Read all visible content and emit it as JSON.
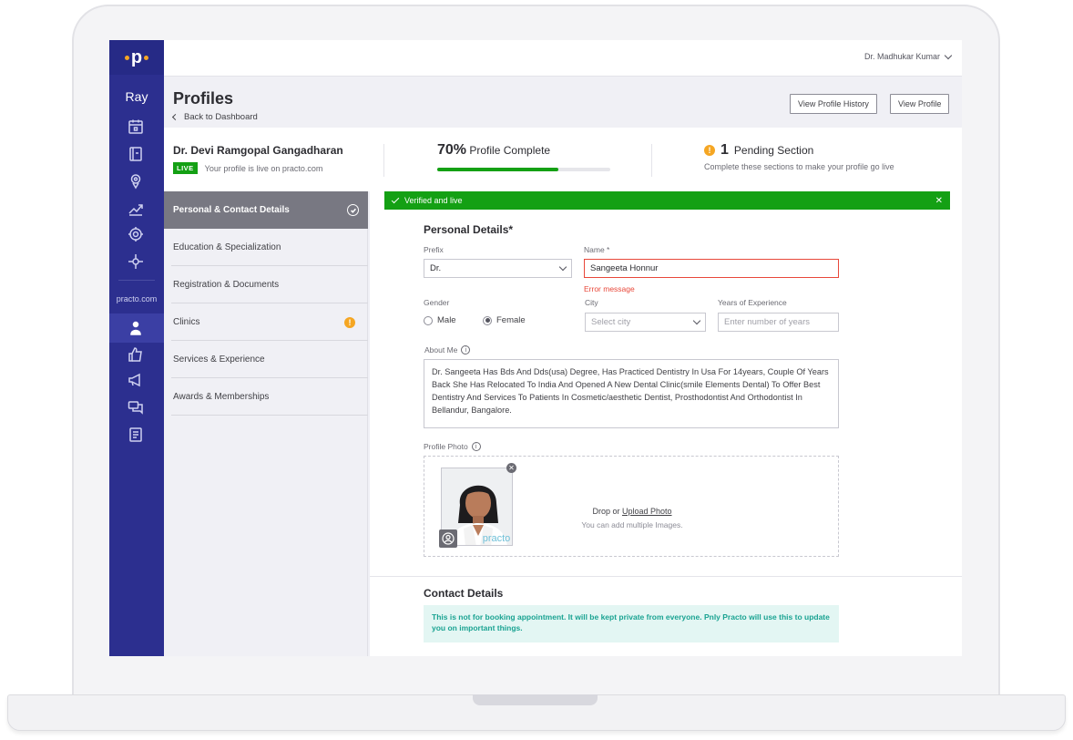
{
  "brand": {
    "logo_text": "p",
    "product": "Ray",
    "site": "practo.com"
  },
  "header": {
    "user_name": "Dr. Madhukar Kumar"
  },
  "page": {
    "title": "Profiles",
    "back_label": "Back to Dashboard",
    "history_button": "View Profile History",
    "view_button": "View Profile"
  },
  "summary": {
    "doctor_name": "Dr. Devi Ramgopal Gangadharan",
    "live_badge": "LIVE",
    "live_text": "Your profile is live on practo.com",
    "progress_percent": 70,
    "progress_value_text": "70%",
    "progress_label": "Profile Complete",
    "pending_count": "1",
    "pending_label": "Pending Section",
    "pending_sub": "Complete these sections to make your profile go live"
  },
  "sections": [
    {
      "label": "Personal & Contact Details",
      "status": "done"
    },
    {
      "label": "Education & Specialization",
      "status": ""
    },
    {
      "label": "Registration & Documents",
      "status": ""
    },
    {
      "label": "Clinics",
      "status": "warning"
    },
    {
      "label": "Services & Experience",
      "status": ""
    },
    {
      "label": "Awards & Memberships",
      "status": ""
    }
  ],
  "banner": {
    "text": "Verified and live"
  },
  "personal": {
    "title": "Personal Details*",
    "prefix_label": "Prefix",
    "prefix_value": "Dr.",
    "name_label": "Name *",
    "name_value": "Sangeeta Honnur",
    "name_error": "Error message",
    "gender_label": "Gender",
    "gender_options": [
      "Male",
      "Female"
    ],
    "gender_selected": "Female",
    "city_label": "City",
    "city_placeholder": "Select city",
    "experience_label": "Years of Experience",
    "experience_placeholder": "Enter number of years",
    "about_label": "About Me",
    "about_value": "Dr. Sangeeta Has Bds And Dds(usa) Degree, Has Practiced Dentistry In Usa For 14years, Couple Of Years Back She Has Relocated To India And Opened A New Dental Clinic(smile Elements Dental) To Offer Best Dentistry And Services To Patients In Cosmetic/aesthetic Dentist, Prosthodontist And Orthodontist In Bellandur, Bangalore.",
    "photo_label": "Profile Photo",
    "photo_watermark": "practo",
    "drop_prefix": "Drop or",
    "drop_link": "Upload Photo",
    "drop_sub": "You can add multiple Images."
  },
  "contact": {
    "title": "Contact Details",
    "notice": "This is not for booking appointment. It will be kept private from everyone. Pnly Practo will use this to update you on important things."
  },
  "colors": {
    "sidebar": "#2c2f8f",
    "success": "#14a014",
    "warning": "#f5a623",
    "error": "#e8483a",
    "notice_text": "#1aa392"
  }
}
